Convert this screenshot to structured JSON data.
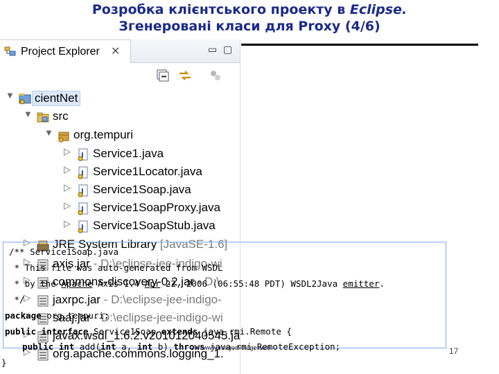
{
  "slide": {
    "title_line1_prefix": "Розробка клієнтського проекту в ",
    "title_line1_italic": "Eclipse.",
    "title_line2": "Згенеровані класи для Proxy (4/6)",
    "page_number": "17",
    "footer_small": "www.imagoevstage.com"
  },
  "panel": {
    "tab_label": "Project Explorer",
    "tab_close": "✕",
    "minimize": "▭",
    "maximize": "▢"
  },
  "tree": [
    {
      "label": "cientNet",
      "icon": "project-icon",
      "arrow": "▼",
      "depth": 0,
      "selected": true
    },
    {
      "label": "src",
      "icon": "source-folder-icon",
      "arrow": "▼",
      "depth": 1
    },
    {
      "label": "org.tempuri",
      "icon": "package-icon",
      "arrow": "▼",
      "depth": 2
    },
    {
      "label": "Service1.java",
      "icon": "java-file-icon",
      "arrow": "▷",
      "depth": 3
    },
    {
      "label": "Service1Locator.java",
      "icon": "java-file-icon",
      "arrow": "▷",
      "depth": 3
    },
    {
      "label": "Service1Soap.java",
      "icon": "java-file-icon",
      "arrow": "▷",
      "depth": 3
    },
    {
      "label": "Service1SoapProxy.java",
      "icon": "java-file-icon",
      "arrow": "▷",
      "depth": 3
    },
    {
      "label": "Service1SoapStub.java",
      "icon": "java-file-icon",
      "arrow": "▷",
      "depth": 3
    },
    {
      "label": "JRE System Library",
      "extra": " [JavaSE-1.6]",
      "icon": "library-icon",
      "arrow": "▷",
      "depth": 1
    },
    {
      "label": "axis.jar",
      "extra": " - D:\\eclipse-jee-indigo-wi",
      "icon": "jar-icon",
      "arrow": "▷",
      "depth": 1
    },
    {
      "label": "commons-discovery-0.2.jar",
      "extra": " - D:\\",
      "icon": "jar-icon",
      "arrow": "▷",
      "depth": 1
    },
    {
      "label": "jaxrpc.jar",
      "extra": " - D:\\eclipse-jee-indigo-",
      "icon": "jar-icon",
      "arrow": "▷",
      "depth": 1
    },
    {
      "label": "saaj.jar",
      "extra": " - D:\\eclipse-jee-indigo-wi",
      "icon": "jar-icon",
      "arrow": "▷",
      "depth": 1
    },
    {
      "label": "javax.wsdl_1.6.2.v201012040545.ja",
      "extra": "",
      "icon": "jar-icon",
      "arrow": "▷",
      "depth": 1
    },
    {
      "label": "org.apache.commons.logging_1.",
      "extra": "",
      "icon": "jar-icon",
      "arrow": "▷",
      "depth": 1
    }
  ],
  "code": {
    "l1": "/** Service1Soap.java",
    "l2a": " * This file was auto-generated from WSDL",
    "l3a": " * by the ",
    "l3b": "Apache",
    "l3c": " Axis 1.4 ",
    "l3d": "Apr",
    "l3e": " 22, 2006 (06:55:48 PDT) WSDL2Java ",
    "l3f": "emitter",
    "l3g": ".",
    "l4": " */",
    "l5a": "package",
    "l5b": " org.tempuri;",
    "l6a": "public interface",
    "l6b": " Service1Soap ",
    "l6c": "extends",
    "l6d": " java.rmi.Remote {",
    "l7a": "    public int",
    "l7b": " add(",
    "l7c": "int",
    "l7d": " a, ",
    "l7e": "int",
    "l7f": " b) ",
    "l7g": "throws",
    "l7h": " java.rmi.RemoteException;",
    "l8": "}"
  }
}
